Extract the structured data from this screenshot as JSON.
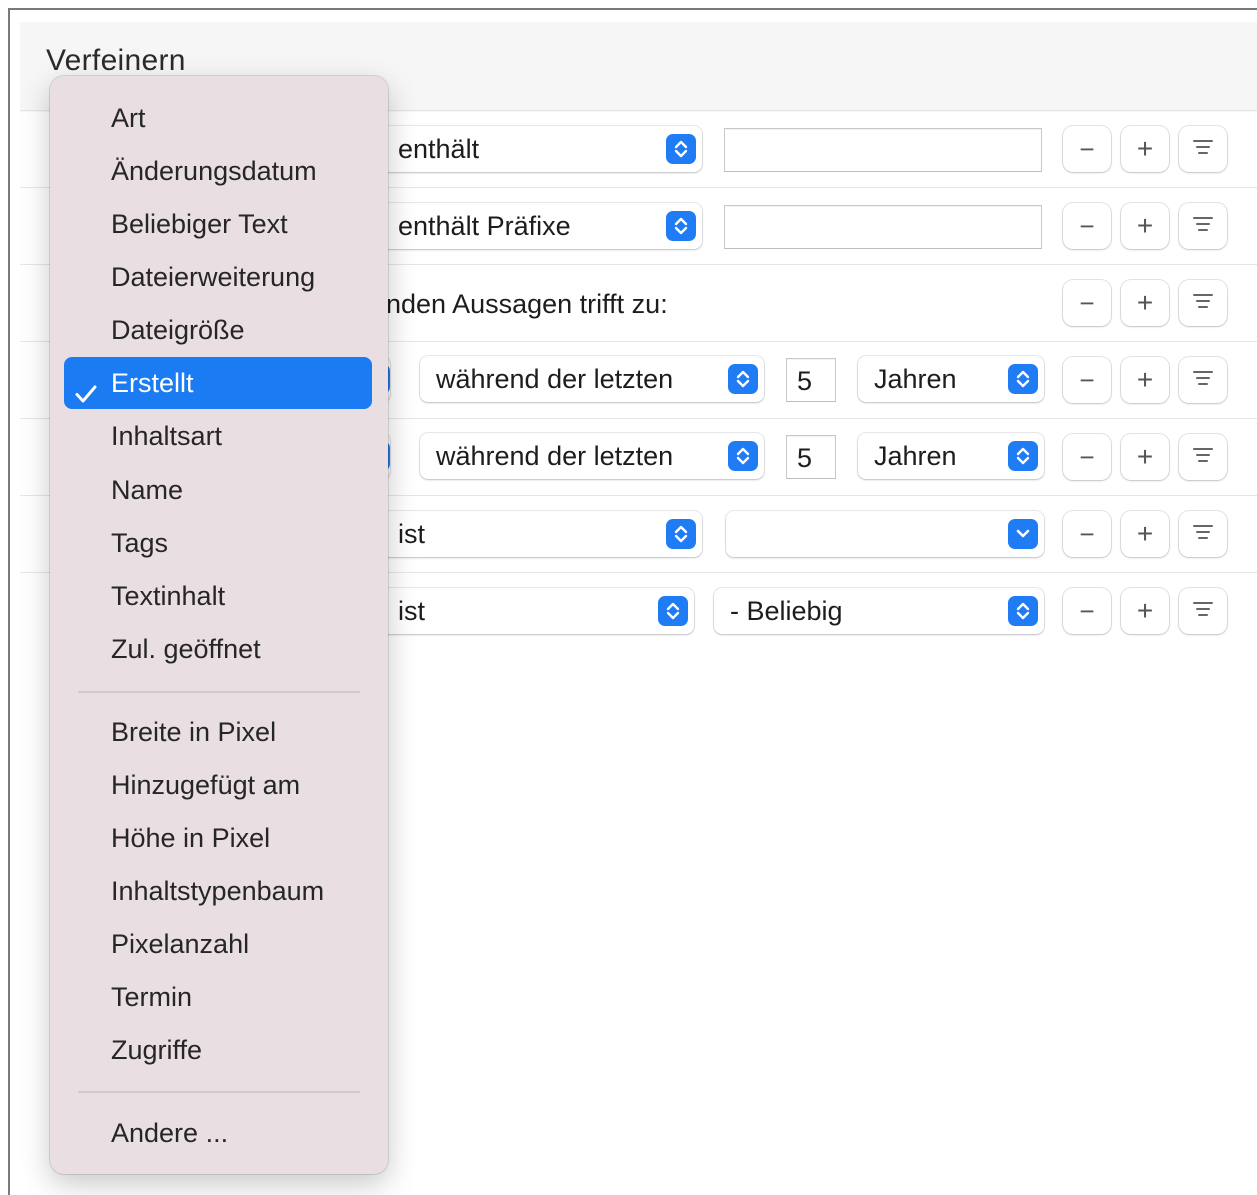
{
  "page": {
    "title": "Verfeinern"
  },
  "rules": [
    {
      "operator": "enthält",
      "value": ""
    },
    {
      "operator": "enthält Präfixe",
      "value": ""
    },
    {
      "text": "nden Aussagen trifft zu:"
    },
    {
      "operator": "während der letzten",
      "number": "5",
      "unit": "Jahren"
    },
    {
      "operator": "während der letzten",
      "number": "5",
      "unit": "Jahren"
    },
    {
      "operator": "ist",
      "value": ""
    },
    {
      "operator": "ist",
      "value": "- Beliebig"
    }
  ],
  "buttons": {
    "minus": "−",
    "plus": "+"
  },
  "menu": {
    "group1": [
      "Art",
      "Änderungsdatum",
      "Beliebiger Text",
      "Dateierweiterung",
      "Dateigröße",
      "Erstellt",
      "Inhaltsart",
      "Name",
      "Tags",
      "Textinhalt",
      "Zul. geöffnet"
    ],
    "group2": [
      "Breite in Pixel",
      "Hinzugefügt am",
      "Höhe in Pixel",
      "Inhaltstypenbaum",
      "Pixelanzahl",
      "Termin",
      "Zugriffe"
    ],
    "group3": [
      "Andere ..."
    ],
    "selected": "Erstellt",
    "check": "✓"
  },
  "colors": {
    "accent": "#1a7bf3",
    "menu_bg": "#e9dfe2"
  }
}
